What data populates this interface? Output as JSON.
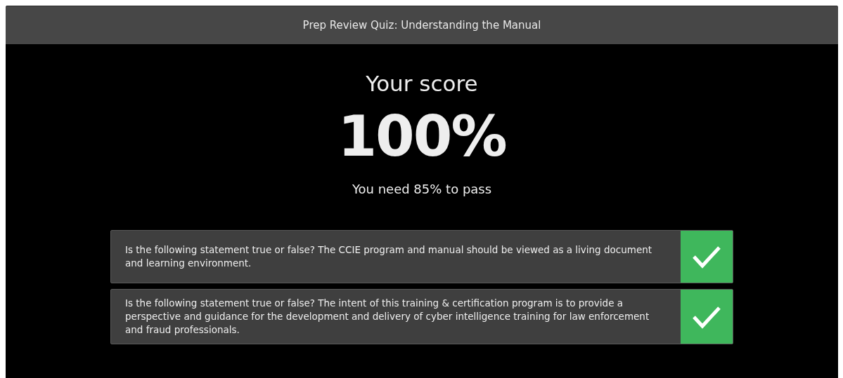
{
  "window": {
    "title": "Prep Review Quiz: Understanding the Manual"
  },
  "score": {
    "heading": "Your score",
    "value": "100%",
    "requirement": "You need 85% to pass"
  },
  "questions": [
    {
      "text": "Is the following statement true or false? The CCIE program and manual should be viewed as a living document and learning environment.",
      "correct": true
    },
    {
      "text": "Is the following statement true or false? The intent of this training & certification program is to provide a perspective and guidance for the development and delivery of cyber intelligence training for law enforcement and fraud professionals.",
      "correct": true
    }
  ]
}
